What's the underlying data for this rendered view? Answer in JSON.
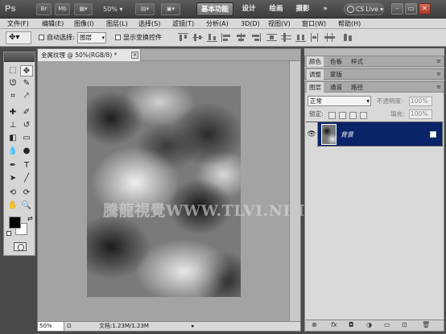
{
  "app": {
    "logo": "Ps",
    "zoom": "50%",
    "cs_live": "CS Live",
    "bridge_label": "Br",
    "mini_bridge_label": "Mb"
  },
  "workspaces": [
    {
      "label": "基本功能",
      "active": true
    },
    {
      "label": "设计",
      "active": false
    },
    {
      "label": "绘画",
      "active": false
    },
    {
      "label": "摄影",
      "active": false
    },
    {
      "label": "»",
      "active": false
    }
  ],
  "window_controls": {
    "minimize": "–",
    "restore": "▭",
    "close": "✕"
  },
  "menu": [
    "文件(F)",
    "编辑(E)",
    "图像(I)",
    "图层(L)",
    "选择(S)",
    "滤镜(T)",
    "分析(A)",
    "3D(D)",
    "视图(V)",
    "窗口(W)",
    "帮助(H)"
  ],
  "options": {
    "auto_select_label": "自动选择:",
    "auto_select_value": "图层",
    "show_transform_label": "显示变换控件"
  },
  "document": {
    "tab_title": "金属纹理 @ 50%(RGB/8) *",
    "close": "×",
    "status_zoom": "50%",
    "status_info": "文档:1.23M/1.23M",
    "watermark": "騰龍視覺WWW.TLVI.NET"
  },
  "panels": {
    "color_tabs": [
      "颜色",
      "色板",
      "样式"
    ],
    "adjust_tabs": [
      "调整",
      "蒙版"
    ],
    "layers_tabs": [
      "图层",
      "通道",
      "路径"
    ],
    "blend_mode": "正常",
    "opacity_label": "不透明度:",
    "opacity_value": "100%",
    "lock_label": "锁定:",
    "fill_label": "填充:",
    "fill_value": "100%",
    "layer_name": "背景"
  },
  "footer_icons": [
    "link-icon",
    "fx-icon",
    "mask-icon",
    "adjustment-icon",
    "group-icon",
    "new-layer-icon",
    "trash-icon"
  ],
  "colors": {
    "selected_layer": "#0a246a",
    "foreground": "#000000",
    "background": "#ffffff"
  }
}
